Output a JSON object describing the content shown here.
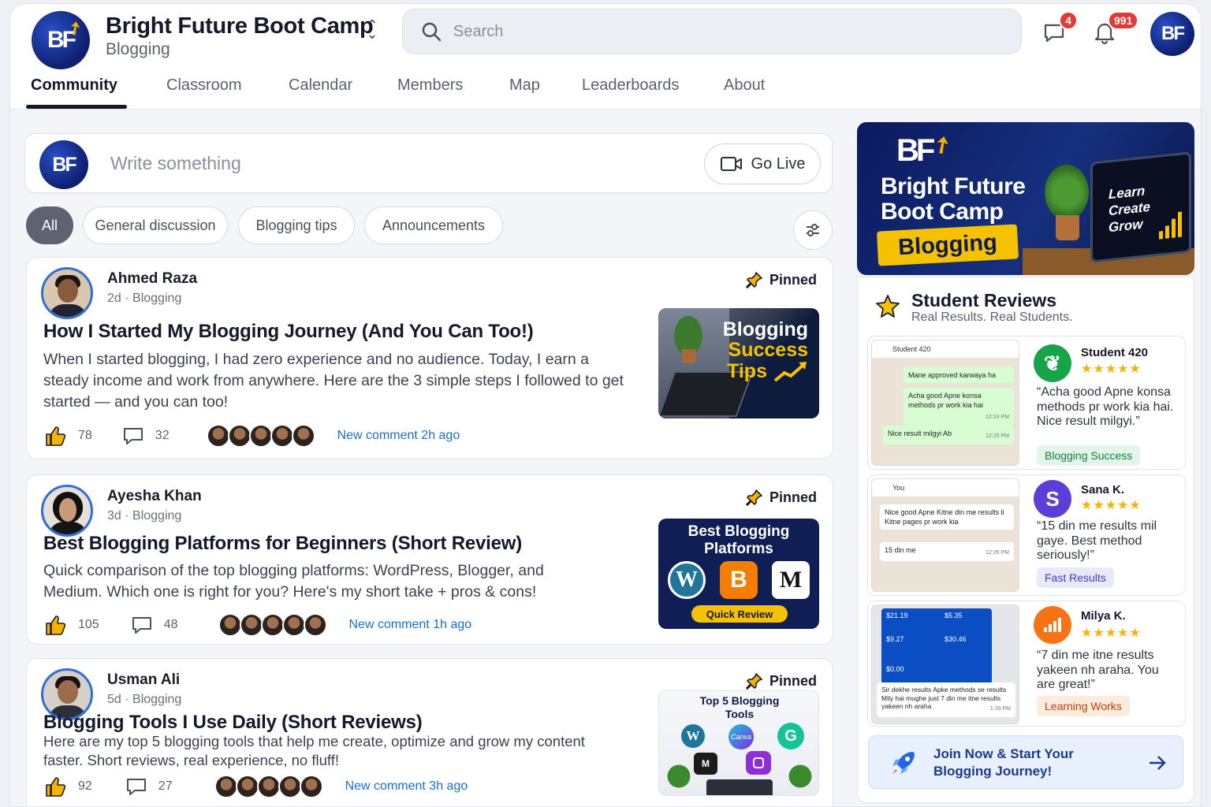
{
  "header": {
    "brand_title": "Bright Future Boot Camp",
    "brand_sub": "Blogging",
    "logo_text": "BF",
    "search_placeholder": "Search",
    "chat_badge": "4",
    "notif_badge": "991"
  },
  "nav": {
    "tabs": [
      "Community",
      "Classroom",
      "Calendar",
      "Members",
      "Map",
      "Leaderboards",
      "About"
    ],
    "active": "Community"
  },
  "composer": {
    "placeholder": "Write something",
    "go_live": "Go Live"
  },
  "filters": [
    "All",
    "General discussion",
    "Blogging tips",
    "Announcements"
  ],
  "posts": [
    {
      "author": "Ahmed Raza",
      "meta": "2d · Blogging",
      "pinned": "Pinned",
      "title": "How I Started My Blogging Journey (And You Can Too!)",
      "excerpt": "When I started blogging, I had zero experience and no audience. Today, I earn a steady income and work from anywhere. Here are the 3 simple steps I followed to get started — and you can too!",
      "likes": "78",
      "comments": "32",
      "new_comment": "New comment 2h ago",
      "thumb_lines": [
        "Blogging",
        "Success",
        "Tips"
      ]
    },
    {
      "author": "Ayesha Khan",
      "meta": "3d · Blogging",
      "pinned": "Pinned",
      "title": "Best Blogging Platforms for Beginners (Short Review)",
      "excerpt": "Quick comparison of the top blogging platforms: WordPress, Blogger, and Medium. Which one is right for you? Here's my short take + pros & cons!",
      "likes": "105",
      "comments": "48",
      "new_comment": "New comment 1h ago",
      "thumb_title": "Best Blogging Platforms",
      "thumb_tag": "Quick Review"
    },
    {
      "author": "Usman Ali",
      "meta": "5d · Blogging",
      "pinned": "Pinned",
      "title": "Blogging Tools I Use Daily (Short Reviews)",
      "excerpt": "Here are my top 5 blogging tools that help me create, optimize and grow my content faster. Short reviews, real experience, no fluff!",
      "likes": "92",
      "comments": "27",
      "new_comment": "New comment 3h ago",
      "thumb_title": "Top 5 Blogging Tools",
      "thumb_canva": "Canva"
    }
  ],
  "banner": {
    "title_line1": "Bright Future",
    "title_line2": "Boot Camp",
    "tag": "Blogging",
    "laptop_lines": [
      "Learn",
      "Create",
      "Grow"
    ]
  },
  "reviews": {
    "title": "Student Reviews",
    "subtitle": "Real Results. Real Students.",
    "items": [
      {
        "name": "Student 420",
        "stars": "★★★★★",
        "quote": "“Acha good Apne konsa methods pr work kia hai. Nice result milgyi.”",
        "tag": "Blogging Success",
        "chat_header": "Student 420",
        "chat": [
          "Mane approved karwaya ha",
          "Acha good Apne konsa methods pr work kia hai",
          "Nice result milgyi Ab"
        ],
        "chat_times": [
          "12:24 PM",
          "12:25 PM"
        ]
      },
      {
        "name": "Sana K.",
        "stars": "★★★★★",
        "quote": "“15 din me results mil gaye. Best method seriously!”",
        "tag": "Fast Results",
        "chat_header": "You",
        "chat": [
          "Nice good Apne Kitne din me results li Kitne pages pr work kia",
          "15 din me"
        ],
        "chat_times": [
          "12:26 PM"
        ]
      },
      {
        "name": "Milya K.",
        "stars": "★★★★★",
        "quote": "“7 din me itne results yakeen nh araha. You are great!”",
        "tag": "Learning Works",
        "chat": [
          "Sir dekhe results Apke methods se results Mily hai mughe just 7 din me itne results yakeen nh araha"
        ],
        "chat_times": [
          "1:39 PM"
        ],
        "amounts": [
          "$21.19",
          "$5.35",
          "$9.27",
          "$30.46",
          "$0.00"
        ]
      }
    ],
    "join_line1": "Join Now & Start Your",
    "join_line2": "Blogging Journey!"
  },
  "colors": {
    "accent_blue": "#1a6fd1",
    "brand_navy": "#0d1f6e",
    "gold": "#f5b400",
    "badge_red": "#e53935"
  }
}
